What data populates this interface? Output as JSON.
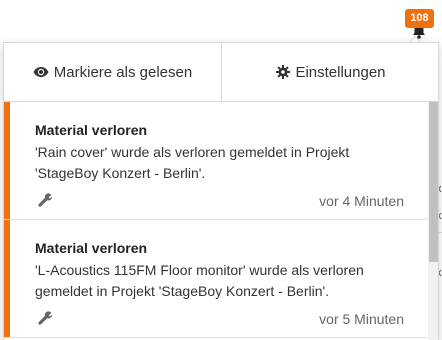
{
  "notifications_badge": {
    "count": "108"
  },
  "actions": {
    "mark_read_label": "Markiere als gelesen",
    "settings_label": "Einstellungen"
  },
  "notifications": [
    {
      "title": "Material verloren",
      "message": "'Rain cover' wurde als verloren gemeldet in Projekt 'StageBoy Konzert - Berlin'.",
      "time": "vor 4 Minuten",
      "icon": "wrench-icon"
    },
    {
      "title": "Material verloren",
      "message": "'L-Acoustics 115FM Floor monitor' wurde als verloren gemeldet in Projekt 'StageBoy Konzert - Berlin'.",
      "time": "vor 5 Minuten",
      "icon": "wrench-icon"
    }
  ],
  "colors": {
    "accent": "#f0700e",
    "border": "#d8d8d8",
    "text": "#333333"
  },
  "background_fragments": [
    "x",
    "x",
    "x"
  ]
}
